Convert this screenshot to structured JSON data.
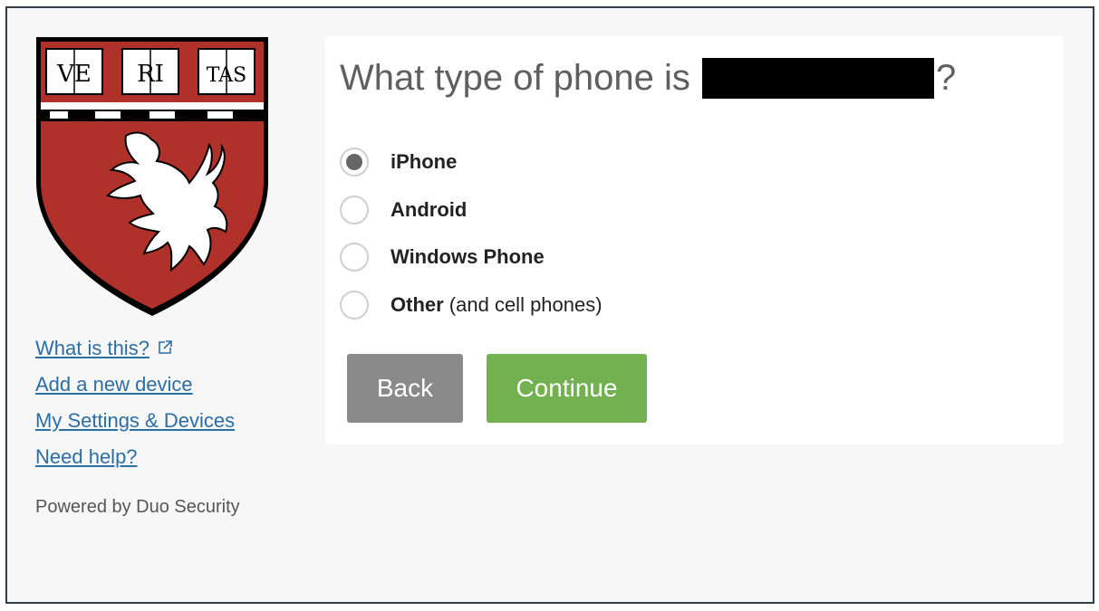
{
  "links": {
    "what_is_this": "What is this?",
    "add_device": "Add a new device",
    "settings": "My Settings & Devices",
    "help": "Need help?"
  },
  "powered_by": "Powered by Duo Security",
  "logo": {
    "books": [
      "VE",
      "RI",
      "TAS"
    ]
  },
  "question": {
    "prefix": "What type of phone is ",
    "suffix": "?"
  },
  "options": [
    {
      "label": "iPhone",
      "sub": "",
      "selected": true
    },
    {
      "label": "Android",
      "sub": "",
      "selected": false
    },
    {
      "label": "Windows Phone",
      "sub": "",
      "selected": false
    },
    {
      "label": "Other",
      "sub": " (and cell phones)",
      "selected": false
    }
  ],
  "buttons": {
    "back": "Back",
    "continue": "Continue"
  },
  "colors": {
    "accent_link": "#2b6ea5",
    "continue": "#72b050",
    "back": "#8a8a8a",
    "shield_red": "#b0302a"
  },
  "icons": {
    "external_link": "external-link-icon",
    "shield": "harvard-shield-icon"
  }
}
